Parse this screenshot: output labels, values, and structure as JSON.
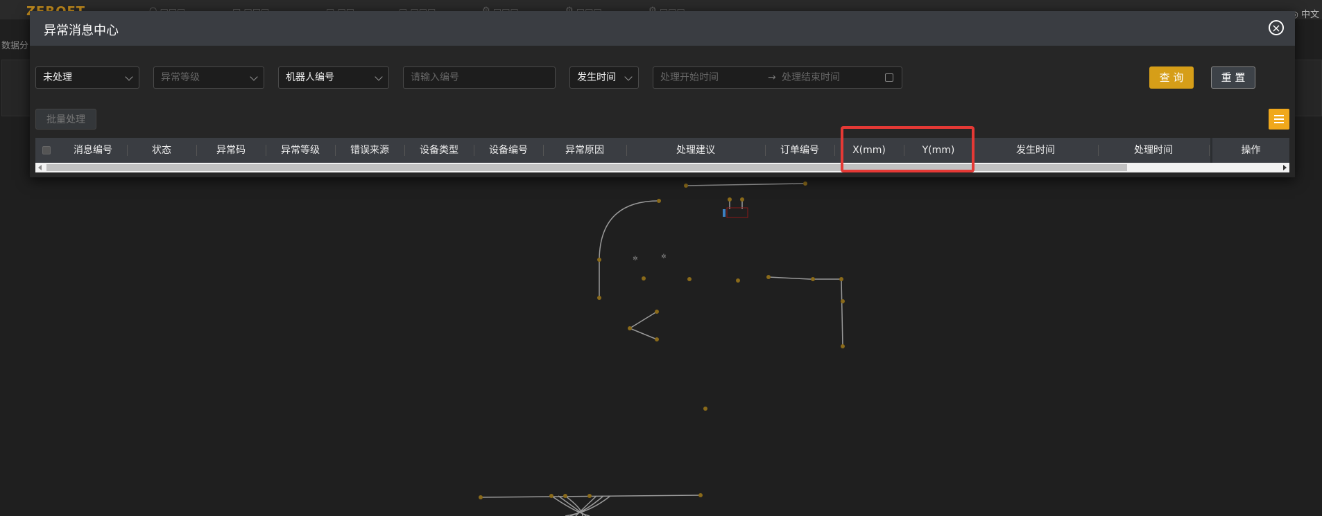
{
  "topnav": {
    "logo": "ZEROET",
    "lang": "中文"
  },
  "breadcrumb": "数据分",
  "modal": {
    "title": "异常消息中心",
    "close_icon": "close-circle-icon"
  },
  "filters": {
    "status_value": "未处理",
    "level_placeholder": "异常等级",
    "robot_value": "机器人编号",
    "code_placeholder": "请输入编号",
    "time_type_value": "发生时间",
    "start_placeholder": "处理开始时间",
    "range_sep": "→",
    "end_placeholder": "处理结束时间"
  },
  "buttons": {
    "query": "查 询",
    "reset": "重 置",
    "batch": "批量处理"
  },
  "table": {
    "columns": [
      "消息编号",
      "状态",
      "异常码",
      "异常等级",
      "错误来源",
      "设备类型",
      "设备编号",
      "异常原因",
      "处理建议",
      "订单编号",
      "X(mm)",
      "Y(mm)",
      "发生时间",
      "处理时间",
      "操作"
    ]
  },
  "colors": {
    "accent": "#d69e18",
    "highlight": "#e53935",
    "header_bg": "#3a3d42"
  }
}
